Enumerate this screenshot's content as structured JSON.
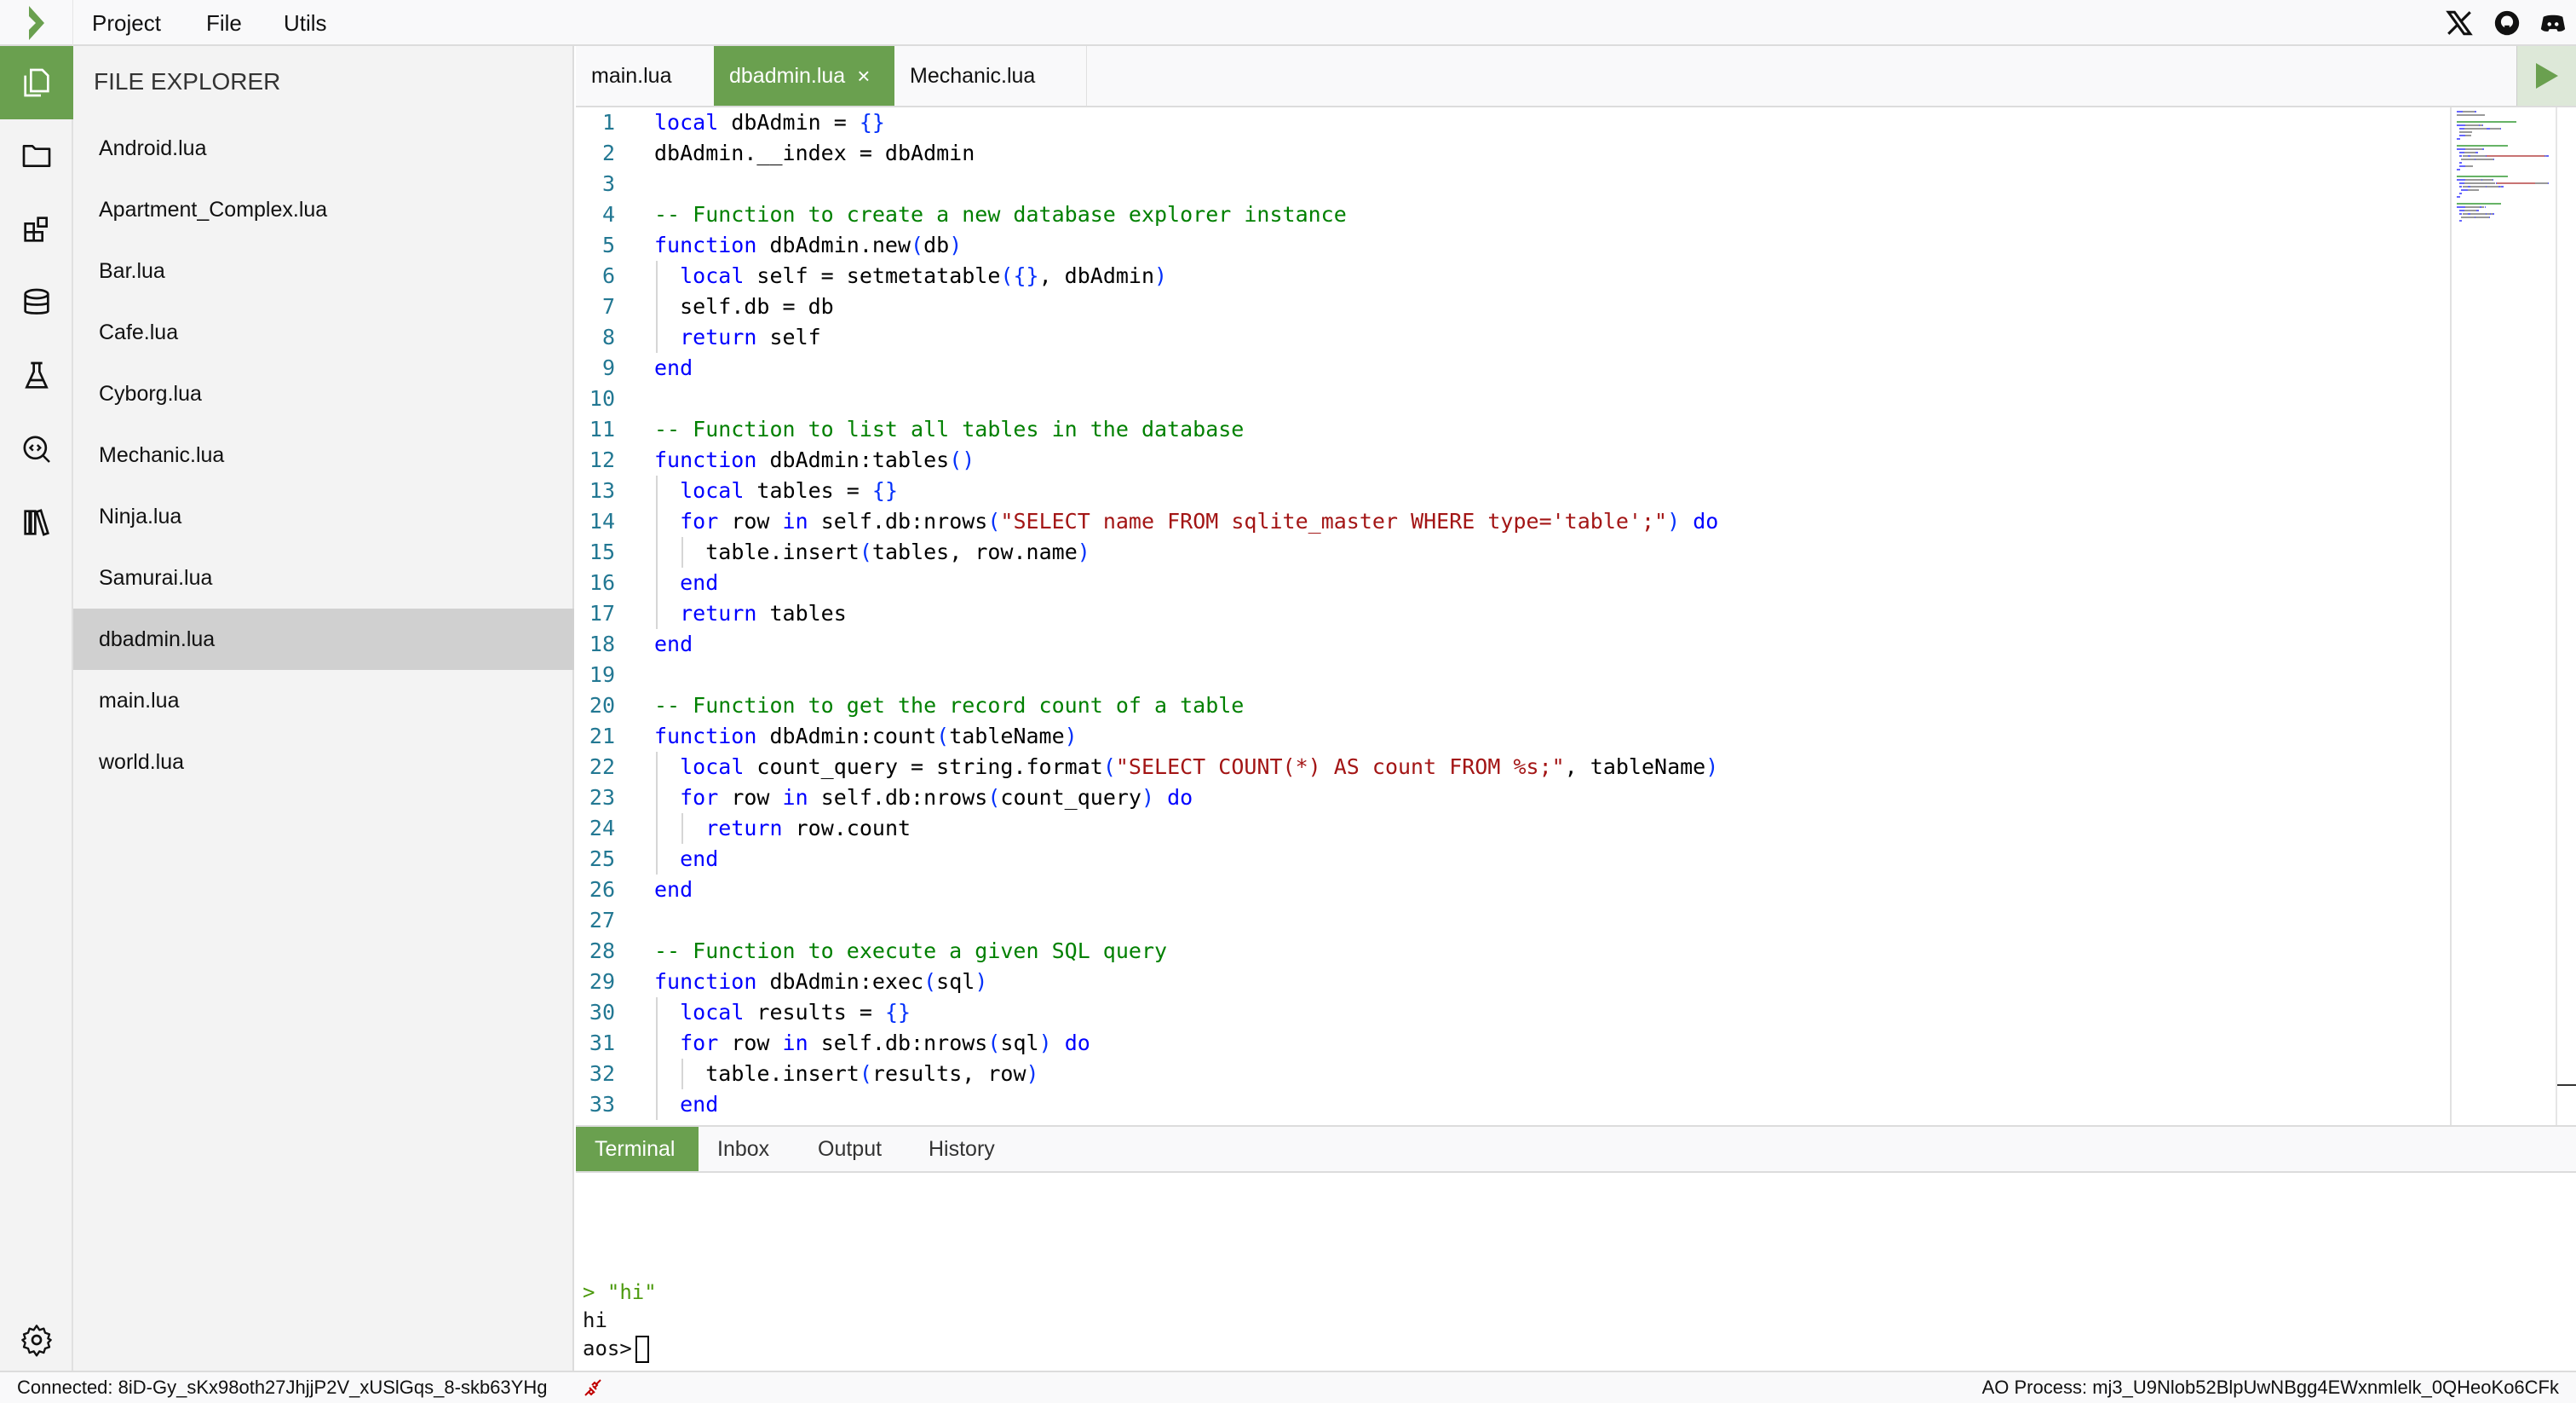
{
  "topbar": {
    "menu": [
      "Project",
      "File",
      "Utils"
    ],
    "social": [
      "x-icon",
      "github-icon",
      "discord-icon"
    ]
  },
  "colors": {
    "accent": "#6aa04f",
    "keyword": "#0000ff",
    "comment": "#008000",
    "string": "#a31515",
    "line_number": "#237893",
    "disconnect_icon": "#c00000"
  },
  "sidebar": {
    "icons": [
      "files-icon",
      "folder-icon",
      "packages-icon",
      "database-icon",
      "flask-icon",
      "code-search-icon",
      "library-icon"
    ],
    "settings_icon": "gear-icon"
  },
  "explorer": {
    "title": "FILE EXPLORER",
    "files": [
      "Android.lua",
      "Apartment_Complex.lua",
      "Bar.lua",
      "Cafe.lua",
      "Cyborg.lua",
      "Mechanic.lua",
      "Ninja.lua",
      "Samurai.lua",
      "dbadmin.lua",
      "main.lua",
      "world.lua"
    ],
    "selected": "dbadmin.lua"
  },
  "tabs": [
    {
      "label": "main.lua",
      "active": false
    },
    {
      "label": "dbadmin.lua",
      "active": true,
      "close": "×"
    },
    {
      "label": "Mechanic.lua",
      "active": false
    }
  ],
  "editor": {
    "lines": [
      {
        "i": 0,
        "t": [
          [
            "k",
            "local"
          ],
          [
            "t",
            " dbAdmin = "
          ],
          [
            "b",
            "{}"
          ]
        ]
      },
      {
        "i": 0,
        "t": [
          [
            "t",
            "dbAdmin.__index = dbAdmin"
          ]
        ]
      },
      {
        "i": 0,
        "t": []
      },
      {
        "i": 0,
        "t": [
          [
            "c",
            "-- Function to create a new database explorer instance"
          ]
        ]
      },
      {
        "i": 0,
        "t": [
          [
            "k",
            "function"
          ],
          [
            "t",
            " dbAdmin.new"
          ],
          [
            "b",
            "("
          ],
          [
            "t",
            "db"
          ],
          [
            "b",
            ")"
          ]
        ]
      },
      {
        "i": 1,
        "t": [
          [
            "k",
            "local"
          ],
          [
            "t",
            " self = setmetatable"
          ],
          [
            "b",
            "("
          ],
          [
            "b",
            "{}"
          ],
          [
            "t",
            ", dbAdmin"
          ],
          [
            "b",
            ")"
          ]
        ]
      },
      {
        "i": 1,
        "t": [
          [
            "t",
            "self.db = db"
          ]
        ]
      },
      {
        "i": 1,
        "t": [
          [
            "k",
            "return"
          ],
          [
            "t",
            " self"
          ]
        ]
      },
      {
        "i": 0,
        "t": [
          [
            "k",
            "end"
          ]
        ]
      },
      {
        "i": 0,
        "t": []
      },
      {
        "i": 0,
        "t": [
          [
            "c",
            "-- Function to list all tables in the database"
          ]
        ]
      },
      {
        "i": 0,
        "t": [
          [
            "k",
            "function"
          ],
          [
            "t",
            " dbAdmin:tables"
          ],
          [
            "b",
            "()"
          ]
        ]
      },
      {
        "i": 1,
        "t": [
          [
            "k",
            "local"
          ],
          [
            "t",
            " tables = "
          ],
          [
            "b",
            "{}"
          ]
        ]
      },
      {
        "i": 1,
        "t": [
          [
            "k",
            "for"
          ],
          [
            "t",
            " row "
          ],
          [
            "k",
            "in"
          ],
          [
            "t",
            " self.db:nrows"
          ],
          [
            "b",
            "("
          ],
          [
            "s",
            "\"SELECT name FROM sqlite_master WHERE type='table';\""
          ],
          [
            "b",
            ")"
          ],
          [
            "t",
            " "
          ],
          [
            "k",
            "do"
          ]
        ]
      },
      {
        "i": 2,
        "t": [
          [
            "t",
            "table.insert"
          ],
          [
            "b",
            "("
          ],
          [
            "t",
            "tables, row.name"
          ],
          [
            "b",
            ")"
          ]
        ]
      },
      {
        "i": 1,
        "t": [
          [
            "k",
            "end"
          ]
        ]
      },
      {
        "i": 1,
        "t": [
          [
            "k",
            "return"
          ],
          [
            "t",
            " tables"
          ]
        ]
      },
      {
        "i": 0,
        "t": [
          [
            "k",
            "end"
          ]
        ]
      },
      {
        "i": 0,
        "t": []
      },
      {
        "i": 0,
        "t": [
          [
            "c",
            "-- Function to get the record count of a table"
          ]
        ]
      },
      {
        "i": 0,
        "t": [
          [
            "k",
            "function"
          ],
          [
            "t",
            " dbAdmin:count"
          ],
          [
            "b",
            "("
          ],
          [
            "t",
            "tableName"
          ],
          [
            "b",
            ")"
          ]
        ]
      },
      {
        "i": 1,
        "t": [
          [
            "k",
            "local"
          ],
          [
            "t",
            " count_query = string.format"
          ],
          [
            "b",
            "("
          ],
          [
            "s",
            "\"SELECT COUNT(*) AS count FROM %s;\""
          ],
          [
            "t",
            ", tableName"
          ],
          [
            "b",
            ")"
          ]
        ]
      },
      {
        "i": 1,
        "t": [
          [
            "k",
            "for"
          ],
          [
            "t",
            " row "
          ],
          [
            "k",
            "in"
          ],
          [
            "t",
            " self.db:nrows"
          ],
          [
            "b",
            "("
          ],
          [
            "t",
            "count_query"
          ],
          [
            "b",
            ")"
          ],
          [
            "t",
            " "
          ],
          [
            "k",
            "do"
          ]
        ]
      },
      {
        "i": 2,
        "t": [
          [
            "k",
            "return"
          ],
          [
            "t",
            " row.count"
          ]
        ]
      },
      {
        "i": 1,
        "t": [
          [
            "k",
            "end"
          ]
        ]
      },
      {
        "i": 0,
        "t": [
          [
            "k",
            "end"
          ]
        ]
      },
      {
        "i": 0,
        "t": []
      },
      {
        "i": 0,
        "t": [
          [
            "c",
            "-- Function to execute a given SQL query"
          ]
        ]
      },
      {
        "i": 0,
        "t": [
          [
            "k",
            "function"
          ],
          [
            "t",
            " dbAdmin:exec"
          ],
          [
            "b",
            "("
          ],
          [
            "t",
            "sql"
          ],
          [
            "b",
            ")"
          ]
        ]
      },
      {
        "i": 1,
        "t": [
          [
            "k",
            "local"
          ],
          [
            "t",
            " results = "
          ],
          [
            "b",
            "{}"
          ]
        ]
      },
      {
        "i": 1,
        "t": [
          [
            "k",
            "for"
          ],
          [
            "t",
            " row "
          ],
          [
            "k",
            "in"
          ],
          [
            "t",
            " self.db:nrows"
          ],
          [
            "b",
            "("
          ],
          [
            "t",
            "sql"
          ],
          [
            "b",
            ")"
          ],
          [
            "t",
            " "
          ],
          [
            "k",
            "do"
          ]
        ]
      },
      {
        "i": 2,
        "t": [
          [
            "t",
            "table.insert"
          ],
          [
            "b",
            "("
          ],
          [
            "t",
            "results, row"
          ],
          [
            "b",
            ")"
          ]
        ]
      },
      {
        "i": 1,
        "t": [
          [
            "k",
            "end"
          ]
        ]
      }
    ]
  },
  "panel": {
    "tabs": [
      "Terminal",
      "Inbox",
      "Output",
      "History"
    ],
    "active": "Terminal"
  },
  "terminal": {
    "input_echo": "> \"hi\"",
    "output": "hi",
    "prompt": "aos>"
  },
  "status": {
    "connected": "Connected: 8iD-Gy_sKx98oth27JhjjP2V_xUSlGqs_8-skb63YHg",
    "process": "AO Process: mj3_U9Nlob52BlpUwNBgg4EWxnmlelk_0QHeoKo6CFk"
  }
}
